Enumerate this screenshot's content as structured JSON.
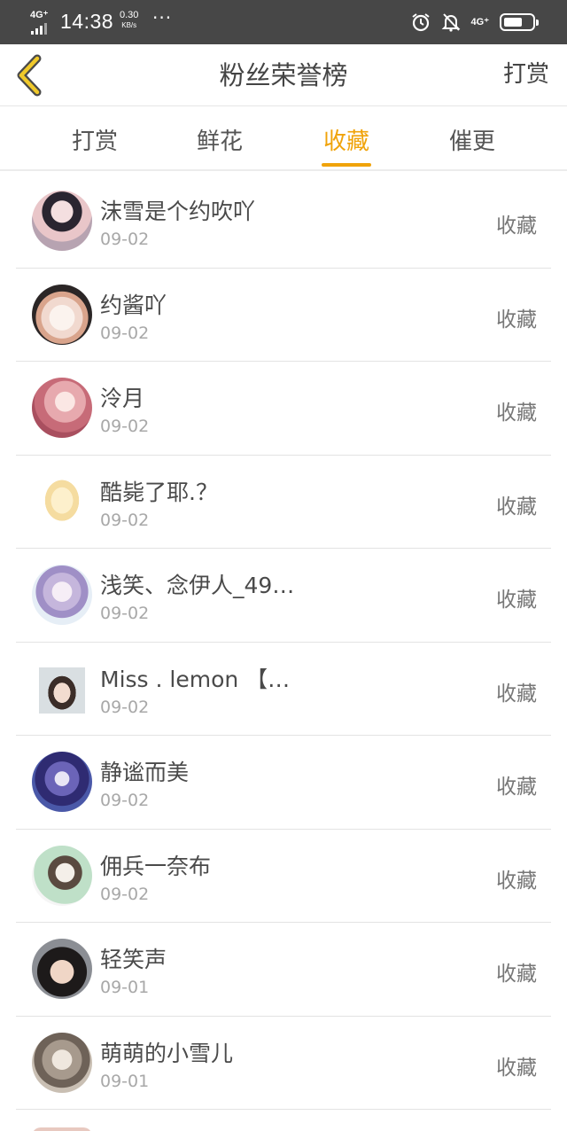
{
  "status_bar": {
    "network_left": "4G⁺",
    "time": "14:38",
    "speed_value": "0.30",
    "speed_unit": "KB/s",
    "overflow": "···",
    "network_right": "4G⁺",
    "battery_level": 0.6,
    "icons": [
      "signal-icon",
      "alarm-icon",
      "bell-off-icon",
      "battery-icon"
    ]
  },
  "nav": {
    "back_icon": "chevron-left-icon",
    "title": "粉丝荣誉榜",
    "action": "打赏",
    "accent": "#f0a30a"
  },
  "tabs": [
    {
      "label": "打赏",
      "active": false
    },
    {
      "label": "鲜花",
      "active": false
    },
    {
      "label": "收藏",
      "active": true
    },
    {
      "label": "催更",
      "active": false
    }
  ],
  "fans": [
    {
      "name": "沫雪是个约吹吖",
      "date": "09-02",
      "status": "收藏"
    },
    {
      "name": "约酱吖",
      "date": "09-02",
      "status": "收藏"
    },
    {
      "name": "泠月",
      "date": "09-02",
      "status": "收藏"
    },
    {
      "name": "酷毙了耶.？",
      "date": "09-02",
      "status": "收藏"
    },
    {
      "name": "浅笑、念伊人_49…",
      "date": "09-02",
      "status": "收藏"
    },
    {
      "name": "Miss . lemon 【…",
      "date": "09-02",
      "status": "收藏"
    },
    {
      "name": "静谧而美",
      "date": "09-02",
      "status": "收藏"
    },
    {
      "name": "佣兵一奈布",
      "date": "09-02",
      "status": "收藏"
    },
    {
      "name": "轻笑声",
      "date": "09-01",
      "status": "收藏"
    },
    {
      "name": "萌萌的小雪儿",
      "date": "09-01",
      "status": "收藏"
    }
  ]
}
